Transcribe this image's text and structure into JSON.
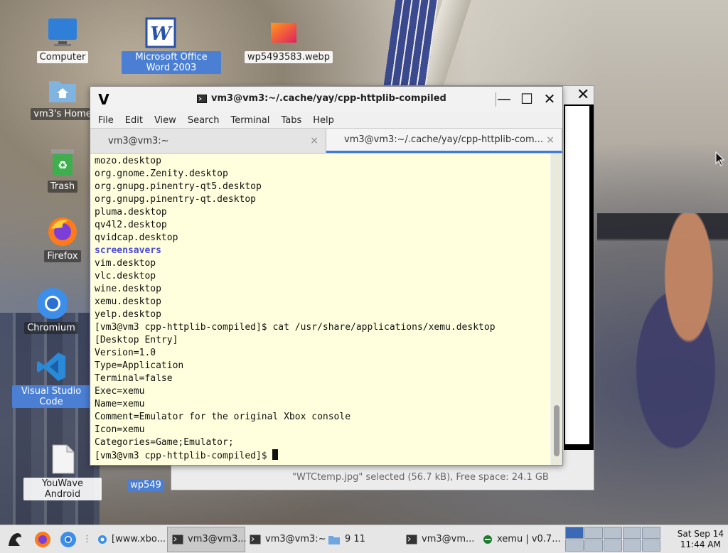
{
  "desktop": {
    "icons": [
      {
        "label": "Computer",
        "icon": "computer-icon"
      },
      {
        "label": "Microsoft Office Word 2003",
        "icon": "word-icon"
      },
      {
        "label": "wp5493583.webp",
        "icon": "image-file-icon"
      },
      {
        "label": "vm3's Home",
        "icon": "home-folder-icon"
      },
      {
        "label": "Trash",
        "icon": "trash-icon"
      },
      {
        "label": "Firefox",
        "icon": "firefox-icon"
      },
      {
        "label": "Chromium",
        "icon": "chromium-icon"
      },
      {
        "label": "Visual Studio Code",
        "icon": "vscode-icon"
      },
      {
        "label": "YouWave Android",
        "icon": "document-icon"
      },
      {
        "label": "wp549",
        "icon": "image-file-icon"
      }
    ]
  },
  "file_manager": {
    "status": "\"WTCtemp.jpg\" selected (56.7 kB), Free space: 24.1 GB"
  },
  "terminal": {
    "title": "vm3@vm3:~/.cache/yay/cpp-httplib-compiled",
    "app_logo": "V",
    "menu": [
      "File",
      "Edit",
      "View",
      "Search",
      "Terminal",
      "Tabs",
      "Help"
    ],
    "tabs": [
      {
        "label": "vm3@vm3:~",
        "active": false
      },
      {
        "label": "vm3@vm3:~/.cache/yay/cpp-httplib-com...",
        "active": true
      }
    ],
    "lines": [
      "mozo.desktop",
      "org.gnome.Zenity.desktop",
      "org.gnupg.pinentry-qt5.desktop",
      "org.gnupg.pinentry-qt.desktop",
      "pluma.desktop",
      "qv4l2.desktop",
      "qvidcap.desktop",
      "screensavers",
      "vim.desktop",
      "vlc.desktop",
      "wine.desktop",
      "xemu.desktop",
      "yelp.desktop",
      "[vm3@vm3 cpp-httplib-compiled]$ cat /usr/share/applications/xemu.desktop",
      "[Desktop Entry]",
      "Version=1.0",
      "Type=Application",
      "Terminal=false",
      "Exec=xemu",
      "Name=xemu",
      "Comment=Emulator for the original Xbox console",
      "Icon=xemu",
      "Categories=Game;Emulator;",
      "[vm3@vm3 cpp-httplib-compiled]$ "
    ],
    "directory_line_index": 7
  },
  "taskbar": {
    "items": [
      {
        "label": "[www.xbo...",
        "icon": "chromium-icon",
        "active": false
      },
      {
        "label": "vm3@vm3...",
        "icon": "terminal-icon",
        "active": true
      },
      {
        "label": "vm3@vm3:~",
        "icon": "terminal-icon",
        "active": false
      },
      {
        "label": "9 11",
        "icon": "folder-icon",
        "active": false
      },
      {
        "label": "vm3@vm...",
        "icon": "terminal-icon",
        "active": false
      },
      {
        "label": "xemu | v0.7...",
        "icon": "xemu-icon",
        "active": false
      }
    ],
    "clock_date": "Sat Sep 14",
    "clock_time": "11:44 AM"
  }
}
